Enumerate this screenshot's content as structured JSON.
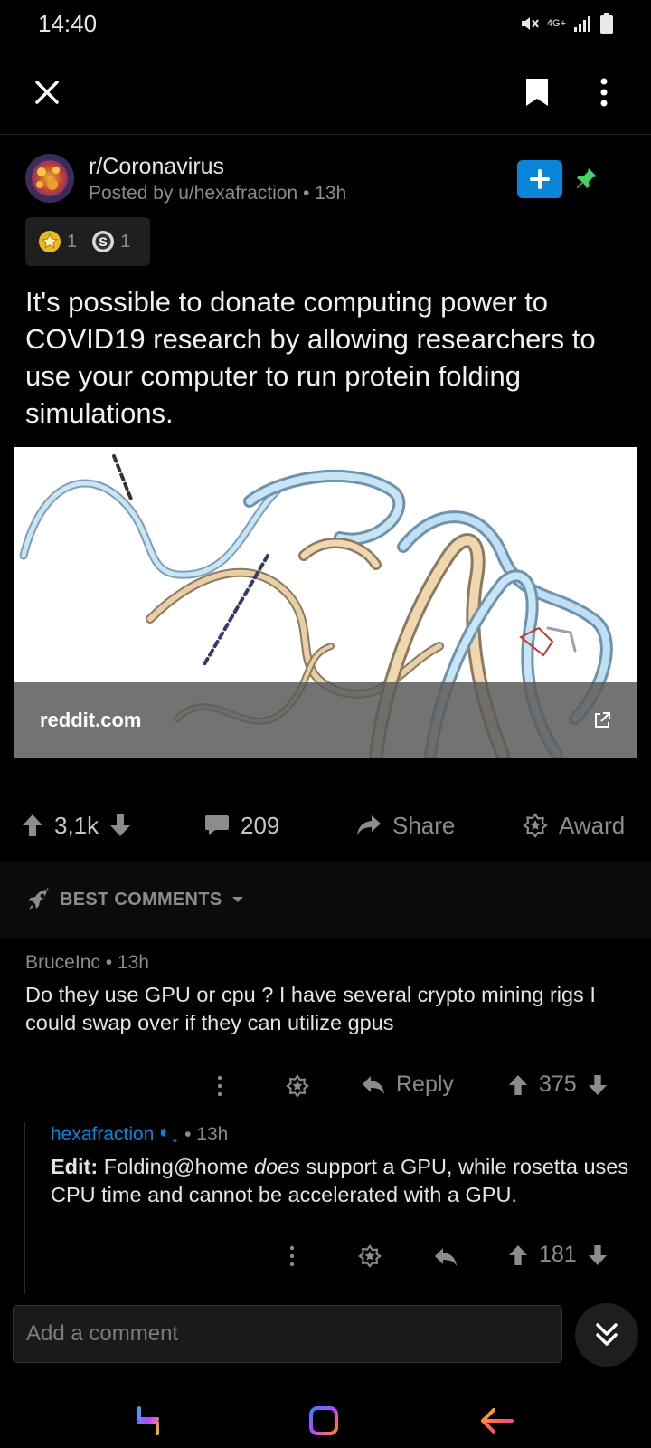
{
  "status_bar": {
    "time": "14:40",
    "network": "4G+"
  },
  "toolbar": {
    "close_icon": "close-icon",
    "save_icon": "bookmark-icon",
    "more_icon": "more-vertical-icon"
  },
  "post": {
    "subreddit": "r/Coronavirus",
    "meta": "Posted by u/hexafraction • 13h",
    "awards": [
      {
        "icon": "gold-award-icon",
        "count": "1"
      },
      {
        "icon": "silver-award-icon",
        "count": "1"
      }
    ],
    "title": "It's possible to donate computing power to COVID19 research by allowing researchers to use your computer to run protein folding simulations.",
    "link_domain": "reddit.com",
    "votes": "3,1k",
    "comments": "209",
    "share_label": "Share",
    "award_label": "Award"
  },
  "sort": {
    "label": "BEST COMMENTS"
  },
  "comments": [
    {
      "author": "BruceInc",
      "time": "13h",
      "body": "Do they use GPU or cpu ? I have several crypto mining rigs I could swap over if they can utilize gpus",
      "reply_label": "Reply",
      "score": "375"
    },
    {
      "author": "hexafraction",
      "time": "13h",
      "body_bold": "Edit:",
      "body_1": " Folding@home ",
      "body_italic": "does",
      "body_2": " support a GPU, while rosetta uses CPU time and cannot be accelerated with a GPU.",
      "score": "181"
    }
  ],
  "composer": {
    "placeholder": "Add a comment"
  },
  "colors": {
    "background": "#000000",
    "accent": "#0A84D8",
    "pin": "#46D160",
    "muted": "#8C8C8C",
    "op_author": "#0A84D8"
  }
}
